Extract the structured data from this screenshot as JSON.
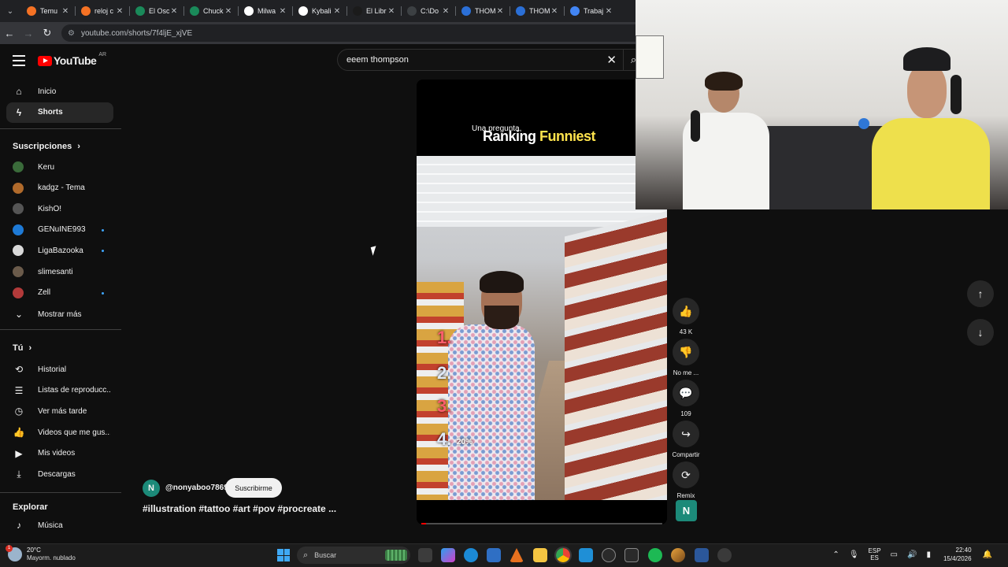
{
  "browser": {
    "tabs": [
      {
        "label": "Temu",
        "color": "#f57224"
      },
      {
        "label": "reloj c",
        "color": "#f57224"
      },
      {
        "label": "El Osc",
        "color": "#1a8a5a"
      },
      {
        "label": "Chuck",
        "color": "#1a8a5a"
      },
      {
        "label": "Milwa",
        "color": "#ffffff"
      },
      {
        "label": "Kybali",
        "color": "#ffffff"
      },
      {
        "label": "El Libr",
        "color": "#1b1b1b"
      },
      {
        "label": "C:\\Do",
        "color": "#3c4043"
      },
      {
        "label": "THOM",
        "color": "#2b6fd6"
      },
      {
        "label": "THOM",
        "color": "#2b6fd6"
      },
      {
        "label": "Trabaj",
        "color": "#4285f4"
      }
    ],
    "url": "youtube.com/shorts/7f4ljE_xjVE"
  },
  "youtube": {
    "logo_text": "YouTube",
    "country_code": "AR",
    "search_value": "eeem thompson"
  },
  "sidebar": {
    "main": [
      {
        "label": "Inicio",
        "icon": "home-icon"
      },
      {
        "label": "Shorts",
        "icon": "shorts-icon",
        "active": true
      }
    ],
    "subs_header": "Suscripciones",
    "subs": [
      {
        "label": "Keru",
        "avatar": "#3a6b3a",
        "dot": false
      },
      {
        "label": "kadgz - Tema",
        "avatar": "#b06a2b",
        "dot": false
      },
      {
        "label": "KishÕ!",
        "avatar": "#555555",
        "dot": false
      },
      {
        "label": "GENuINE993",
        "avatar": "#1e7ad6",
        "dot": true
      },
      {
        "label": "LigaBazooka",
        "avatar": "#d9d9d9",
        "dot": true
      },
      {
        "label": "slimesanti",
        "avatar": "#6b5b4b",
        "dot": false
      },
      {
        "label": "Zell",
        "avatar": "#b23a3a",
        "dot": true
      }
    ],
    "show_more": "Mostrar más",
    "you_header": "Tú",
    "you": [
      {
        "label": "Historial",
        "icon": "history-icon"
      },
      {
        "label": "Listas de reproducc...",
        "icon": "playlists-icon"
      },
      {
        "label": "Ver más tarde",
        "icon": "watch-later-icon"
      },
      {
        "label": "Videos que me gus...",
        "icon": "liked-videos-icon"
      },
      {
        "label": "Mis videos",
        "icon": "my-videos-icon"
      },
      {
        "label": "Descargas",
        "icon": "downloads-icon"
      }
    ],
    "explore_header": "Explorar",
    "explore": [
      {
        "label": "Música",
        "icon": "music-icon"
      }
    ]
  },
  "short": {
    "overlay_small": "Una pregunta,",
    "overlay_title_a": "Ranking ",
    "overlay_title_b": "Funniest",
    "ranks": [
      "1.",
      "2.",
      "3.",
      "4."
    ],
    "rank_pct": "20%",
    "progress": 0.02,
    "channel_initial": "N",
    "channel_name": "@nonyaboo7869",
    "subscribe_label": "Suscribirme",
    "title": "#illustration #tattoo #art #pov #procreate ..."
  },
  "actions": [
    {
      "name": "like",
      "icon": "like-icon",
      "glyph": "👍",
      "label": "43 K"
    },
    {
      "name": "dislike",
      "icon": "dislike-icon",
      "glyph": "👎",
      "label": "No me ..."
    },
    {
      "name": "comments",
      "icon": "comment-icon",
      "glyph": "💬",
      "label": "109"
    },
    {
      "name": "share",
      "icon": "share-icon",
      "glyph": "↪",
      "label": "Compartir"
    },
    {
      "name": "remix",
      "icon": "remix-icon",
      "glyph": "⟳",
      "label": "Remix"
    }
  ],
  "taskbar": {
    "weather_temp": "20°C",
    "weather_desc": "Mayorm. nublado",
    "weather_badge": "1",
    "search_placeholder": "Buscar",
    "lang_top": "ESP",
    "lang_bottom": "ES",
    "time": "22:40",
    "date": "15/4/2026"
  }
}
